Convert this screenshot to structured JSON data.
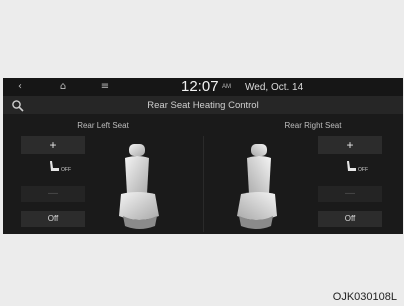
{
  "topbar": {
    "back_icon": "‹",
    "home_icon": "⌂",
    "menu_icon": "≡",
    "time": "12:07",
    "ampm": "AM",
    "date": "Wed, Oct. 14"
  },
  "title": "Rear Seat Heating Control",
  "left": {
    "label": "Rear Left Seat",
    "plus": "+",
    "level": "OFF",
    "minus": "—",
    "off_button": "Off"
  },
  "right": {
    "label": "Rear Right Seat",
    "plus": "+",
    "level": "OFF",
    "minus": "—",
    "off_button": "Off"
  },
  "image_code": "OJK030108L"
}
